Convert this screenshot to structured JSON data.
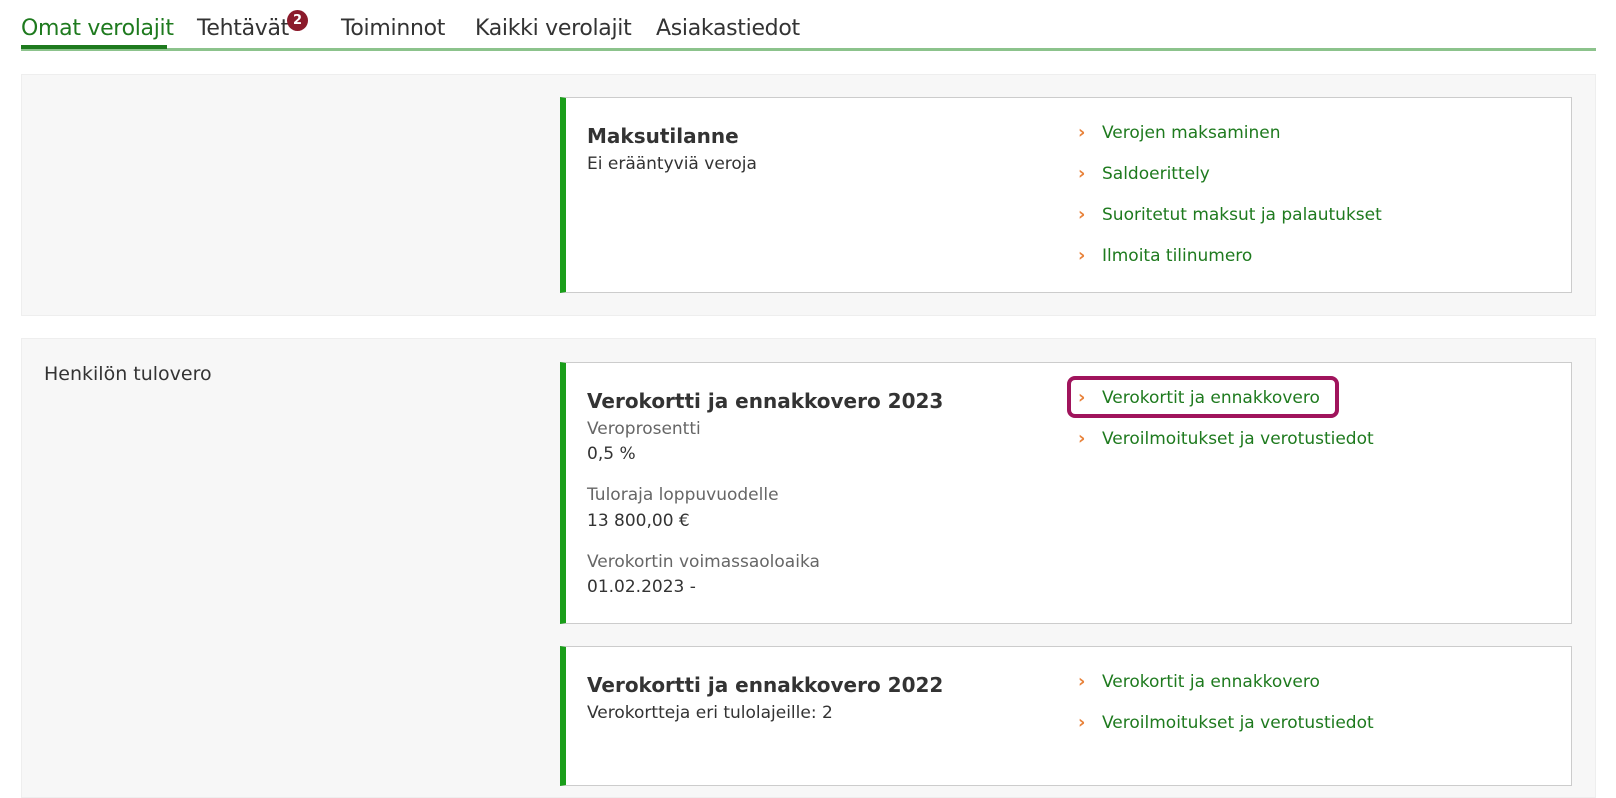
{
  "tabs": [
    {
      "label": "Omat verolajit",
      "active": true
    },
    {
      "label": "Tehtävät",
      "badge": "2"
    },
    {
      "label": "Toiminnot"
    },
    {
      "label": "Kaikki verolajit"
    },
    {
      "label": "Asiakastiedot"
    }
  ],
  "payment": {
    "title": "Maksutilanne",
    "text": "Ei erääntyviä veroja",
    "links": [
      "Verojen maksaminen",
      "Saldoerittely",
      "Suoritetut maksut ja palautukset",
      "Ilmoita tilinumero"
    ]
  },
  "income_tax": {
    "section_title": "Henkilön tulovero",
    "card2023": {
      "title": "Verokortti ja ennakkovero 2023",
      "rate_label": "Veroprosentti",
      "rate_value": "0,5 %",
      "limit_label": "Tuloraja loppuvuodelle",
      "limit_value": "13 800,00 €",
      "validity_label": "Verokortin voimassaoloaika",
      "validity_value": "01.02.2023 -",
      "links": [
        "Verokortit ja ennakkovero",
        "Veroilmoitukset ja verotustiedot"
      ]
    },
    "card2022": {
      "title": "Verokortti ja ennakkovero 2022",
      "text": "Verokortteja eri tulolajeille: 2",
      "links": [
        "Verokortit ja ennakkovero",
        "Veroilmoitukset ja verotustiedot"
      ]
    }
  },
  "colors": {
    "accent_green": "#1e7a1e",
    "card_border": "#1a9e1a",
    "chevron": "#e8823a",
    "highlight": "#a0145c",
    "badge": "#8b1a2b"
  },
  "icons": {
    "link_icon": "chevron-right-icon"
  }
}
